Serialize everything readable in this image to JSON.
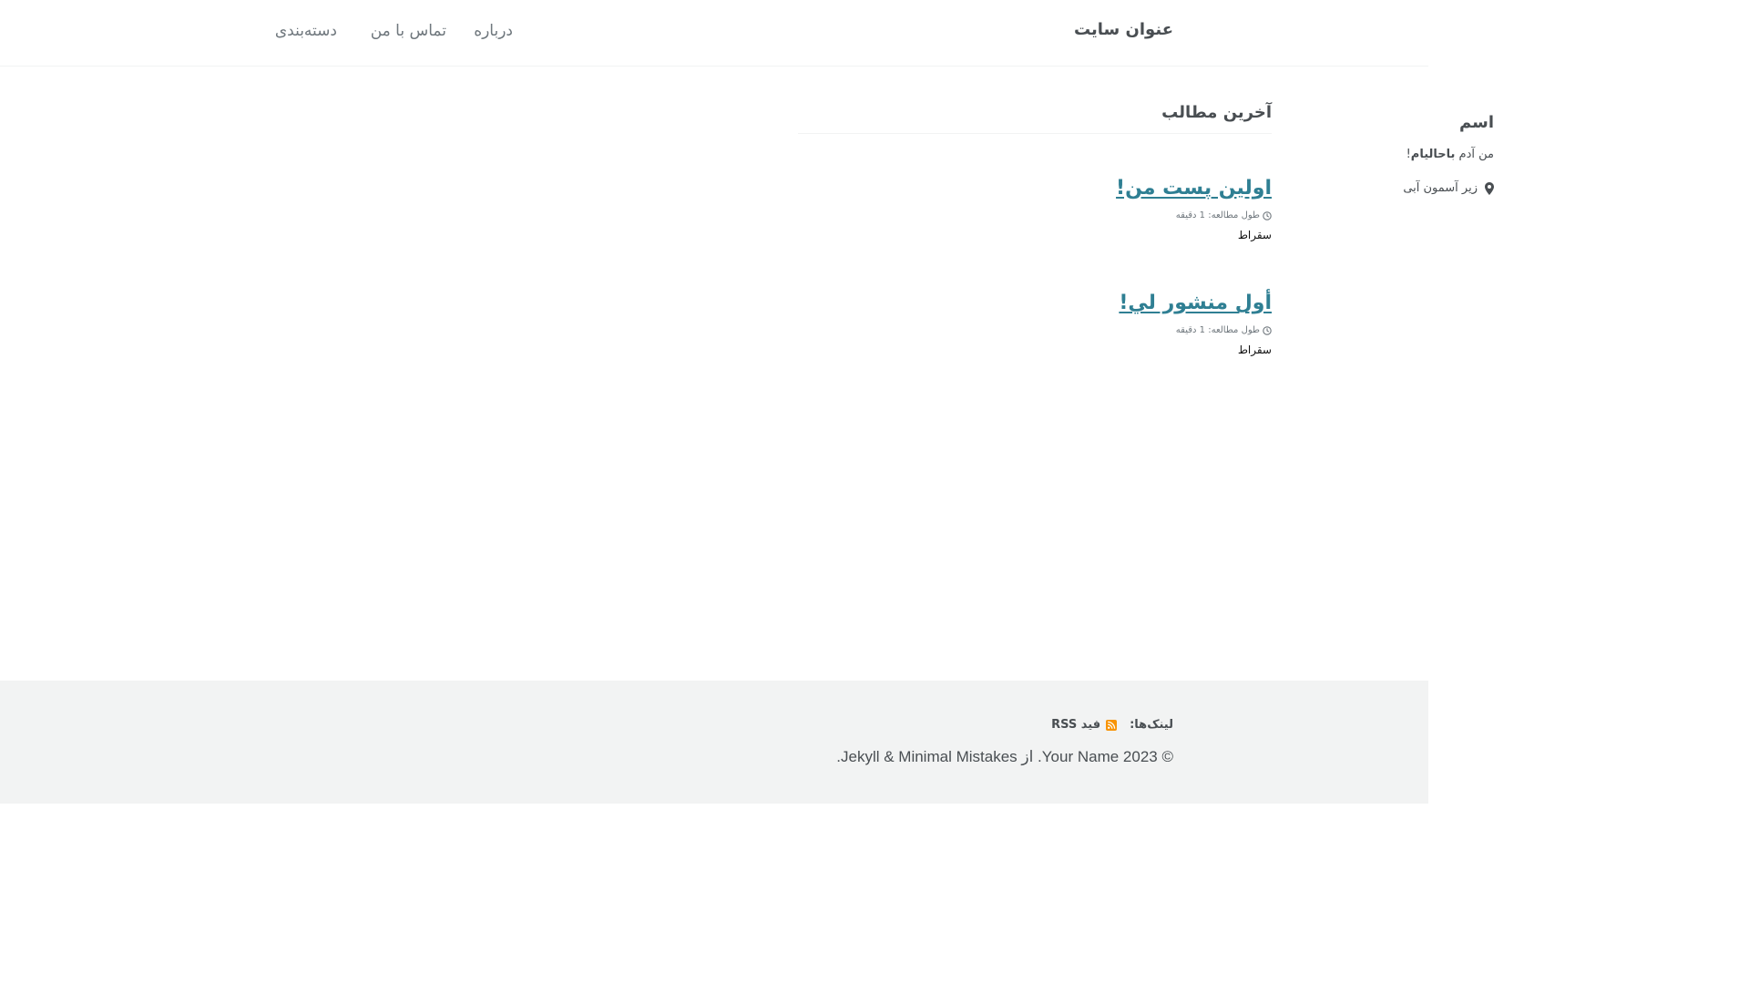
{
  "header": {
    "site_title": "عنوان سایت",
    "nav": {
      "about": "درباره",
      "contact": "تماس با من",
      "category": "دسته‌بندی"
    }
  },
  "author": {
    "name": "اسم",
    "bio_prefix": "من آدم ",
    "bio_bold": "باحالیام",
    "bio_suffix": "!",
    "location": "زیر آسمون آبی",
    "location_icon": "map-marker-icon"
  },
  "main": {
    "archive_title": "آخرین مطالب",
    "posts": [
      {
        "title": "اولین پست من!",
        "reading_time": "طول مطالعه: 1 دقیقه",
        "excerpt": "سقراط"
      },
      {
        "title": "أول منشور لي!",
        "reading_time": "طول مطالعه: 1 دقیقه",
        "excerpt": "سقراط"
      }
    ],
    "clock_icon": "clock-icon"
  },
  "footer": {
    "links_label": "لینک‌ها:",
    "rss_label": "فید RSS",
    "rss_icon": "rss-icon",
    "rss_icon_color": "#f89406",
    "copyright": "© 2023 Your Name. از Jekyll & Minimal Mistakes."
  },
  "colors": {
    "link": "#2f7f93",
    "text": "#494e52",
    "footer_bg": "#f2f3f3"
  }
}
